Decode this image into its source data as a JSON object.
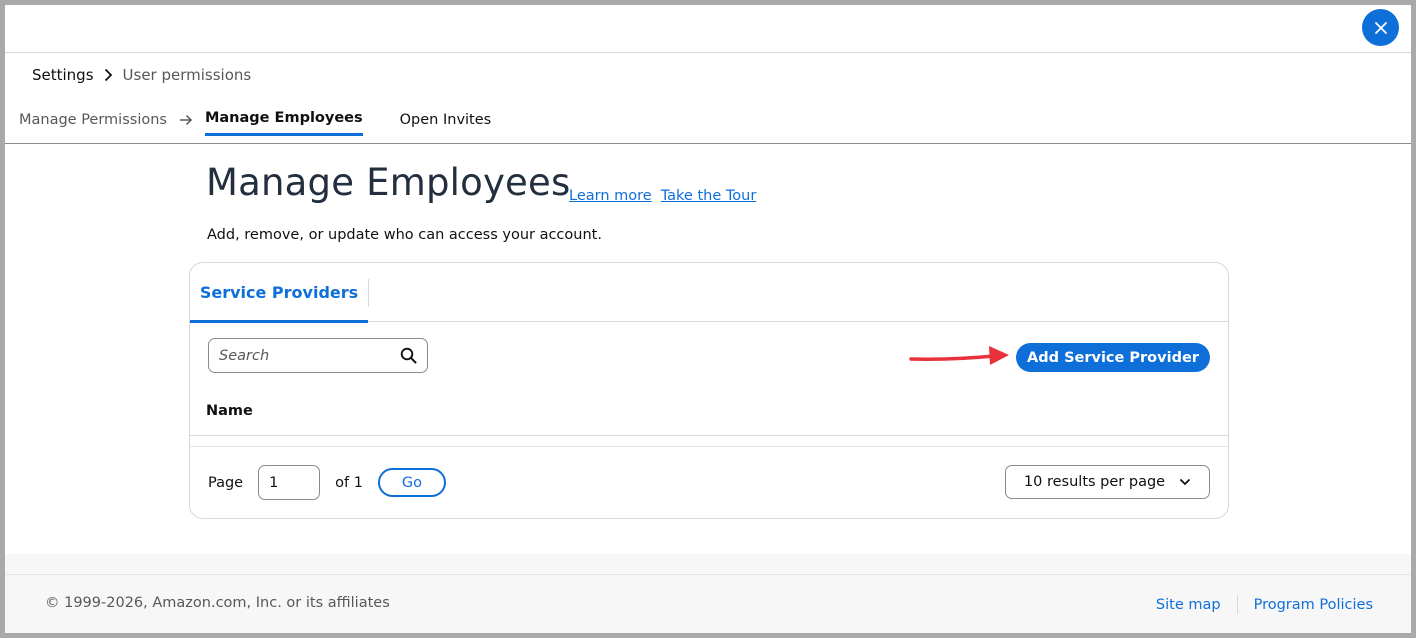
{
  "breadcrumb": {
    "root": "Settings",
    "current": "User permissions"
  },
  "steps": {
    "step1": "Manage Permissions",
    "step2": "Manage Employees",
    "invites": "Open Invites"
  },
  "page": {
    "title": "Manage Employees",
    "learn_more": "Learn more",
    "take_tour": "Take the Tour",
    "subtitle": "Add, remove, or update who can access your account."
  },
  "card": {
    "tab_label": "Service Providers",
    "search_placeholder": "Search",
    "add_button": "Add Service Provider",
    "column_name": "Name"
  },
  "pager": {
    "page_label": "Page",
    "page_value": "1",
    "of_label": "of 1",
    "go_label": "Go",
    "per_page": "10 results per page"
  },
  "footer": {
    "copyright": "© 1999-2026, Amazon.com, Inc. or its affiliates",
    "site_map": "Site map",
    "program_policies": "Program Policies"
  },
  "colors": {
    "accent": "#0f6fd8",
    "annotation_arrow": "#e8313a"
  },
  "icons": {
    "close": "close-icon",
    "search": "search-icon",
    "chevron": "chevron-down-icon",
    "breadcrumb_sep": "chevron-right-icon",
    "step_arrow": "arrow-right-icon"
  }
}
